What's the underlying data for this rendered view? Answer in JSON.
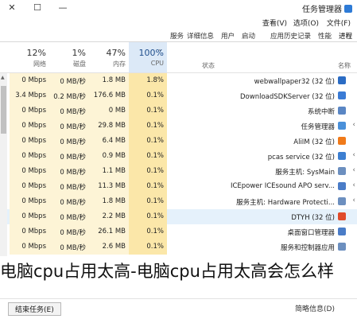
{
  "window": {
    "title": "任务管理器",
    "controls": {
      "close": "✕",
      "maximize": "☐",
      "minimize": "—"
    }
  },
  "menu": [
    "文件(F)",
    "选项(O)",
    "查看(V)"
  ],
  "tabs": [
    "进程",
    "性能",
    "应用历史记录",
    "启动",
    "用户",
    "详细信息",
    "服务"
  ],
  "columns": {
    "cpu": {
      "pct": "100%",
      "label": "CPU"
    },
    "memory": {
      "pct": "47%",
      "label": "内存"
    },
    "disk": {
      "pct": "1%",
      "label": "磁盘"
    },
    "network": {
      "pct": "12%",
      "label": "网络"
    },
    "status": "状态",
    "name": "名称"
  },
  "rows": [
    {
      "name": "webwallpaper32 (32 位)",
      "cpu": "1.8%",
      "memory": "1.8 MB",
      "disk": "0 MB/秒",
      "network": "0 Mbps",
      "expand": false
    },
    {
      "name": "DownloadSDKServer (32 位)",
      "cpu": "0.1%",
      "memory": "176.6 MB",
      "disk": "0.2 MB/秒",
      "network": "3.4 Mbps",
      "expand": false
    },
    {
      "name": "系统中断",
      "cpu": "0.1%",
      "memory": "0 MB",
      "disk": "0 MB/秒",
      "network": "0 Mbps",
      "expand": false
    },
    {
      "name": "任务管理器",
      "cpu": "0.1%",
      "memory": "29.8 MB",
      "disk": "0 MB/秒",
      "network": "0 Mbps",
      "expand": true
    },
    {
      "name": "AliIM (32 位)",
      "cpu": "0.1%",
      "memory": "6.4 MB",
      "disk": "0 MB/秒",
      "network": "0 Mbps",
      "expand": false
    },
    {
      "name": "pcas service (32 位)",
      "cpu": "0.1%",
      "memory": "0.9 MB",
      "disk": "0 MB/秒",
      "network": "0 Mbps",
      "expand": true
    },
    {
      "name": "服务主机: SysMain",
      "cpu": "0.1%",
      "memory": "1.1 MB",
      "disk": "0 MB/秒",
      "network": "0 Mbps",
      "expand": true
    },
    {
      "name": "ICEpower ICEsound APO serv...",
      "cpu": "0.1%",
      "memory": "11.3 MB",
      "disk": "0 MB/秒",
      "network": "0 Mbps",
      "expand": true
    },
    {
      "name": "服务主机: Hardware Protecti...",
      "cpu": "0.1%",
      "memory": "1.8 MB",
      "disk": "0 MB/秒",
      "network": "0 Mbps",
      "expand": true
    },
    {
      "name": "DTYH (32 位)",
      "cpu": "0.1%",
      "memory": "2.2 MB",
      "disk": "0 MB/秒",
      "network": "0 Mbps",
      "expand": false,
      "selected": true
    },
    {
      "name": "桌面窗口管理器",
      "cpu": "0.1%",
      "memory": "26.1 MB",
      "disk": "0 MB/秒",
      "network": "0 Mbps",
      "expand": false
    },
    {
      "name": "服务和控制器应用",
      "cpu": "0.1%",
      "memory": "2.6 MB",
      "disk": "0 MB/秒",
      "network": "0 Mbps",
      "expand": false
    }
  ],
  "bottom": {
    "fewer_details": "简略信息(D)",
    "end_task": "结束任务(E)"
  },
  "overlay_text": "电脑cpu占用太高-电脑cpu占用太高会怎么样",
  "colors": {
    "cpu_col": "#fbe7a9",
    "col": "#fdf4d6",
    "selected": "#e5f1fb"
  }
}
